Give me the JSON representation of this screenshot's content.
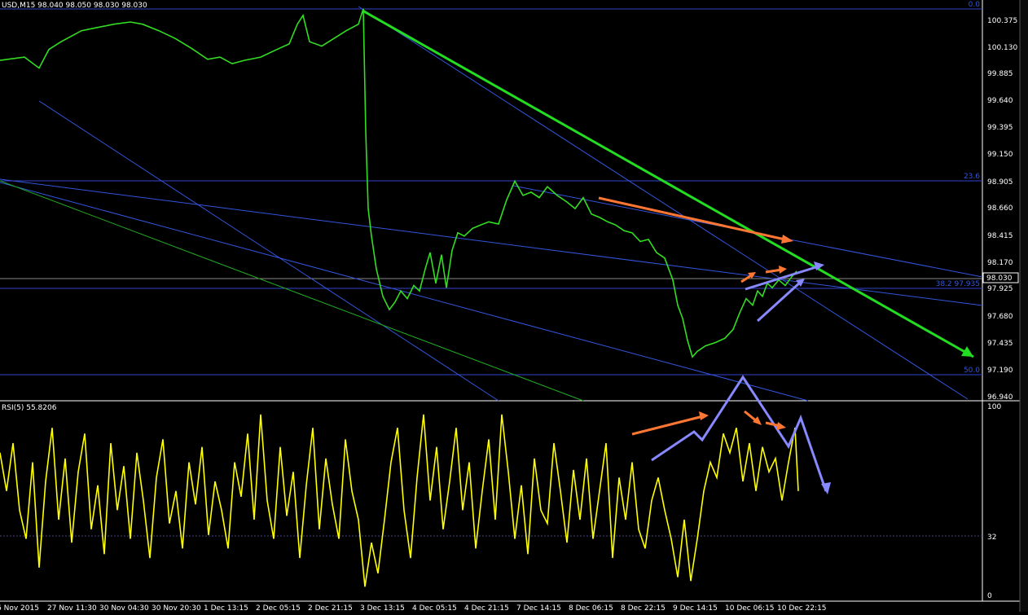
{
  "chart_data": [
    {
      "type": "line",
      "panel": "price",
      "title": "USD,M15  98.040 98.050 98.030 98.030",
      "current_price_label": "98.030",
      "ylim": [
        96.85,
        100.5
      ],
      "y_ticks": [
        100.375,
        100.13,
        99.885,
        99.64,
        99.395,
        99.15,
        98.905,
        98.66,
        98.415,
        98.17,
        97.925,
        97.68,
        97.435,
        97.19,
        96.94
      ],
      "y_tick_labels": [
        "100.375",
        "100.130",
        "99.885",
        "99.640",
        "99.395",
        "99.150",
        "98.905",
        "98.660",
        "98.415",
        "98.170",
        "97.925",
        "97.680",
        "97.435",
        "97.190",
        "96.940"
      ],
      "series": [
        {
          "color": "#33dd22",
          "x": [
            0,
            30,
            48,
            60,
            75,
            100,
            120,
            140,
            160,
            175,
            195,
            215,
            235,
            255,
            270,
            285,
            300,
            320,
            340,
            355,
            365,
            372,
            380,
            395,
            410,
            425,
            440,
            446,
            449,
            452,
            456,
            462,
            470,
            478,
            485,
            492,
            500,
            508,
            515,
            522,
            528,
            535,
            542,
            548,
            555,
            562,
            570,
            580,
            590,
            600,
            612,
            622,
            632,
            642,
            652,
            662,
            672,
            684,
            696,
            706,
            716,
            726,
            736,
            746,
            756,
            766,
            776,
            786,
            796,
            806,
            816,
            826,
            832,
            838,
            844,
            850,
            856,
            866,
            878,
            890,
            900,
            908,
            916,
            924,
            930,
            936,
            942,
            948,
            956,
            964,
            972,
            978
          ],
          "values": [
            99.95,
            99.98,
            99.88,
            100.05,
            100.12,
            100.22,
            100.25,
            100.28,
            100.3,
            100.28,
            100.22,
            100.15,
            100.06,
            99.96,
            99.98,
            99.92,
            99.95,
            99.98,
            100.05,
            100.1,
            100.28,
            100.36,
            100.12,
            100.08,
            100.15,
            100.22,
            100.28,
            100.42,
            99.3,
            98.6,
            98.35,
            98.05,
            97.8,
            97.68,
            97.75,
            97.85,
            97.78,
            97.9,
            97.85,
            98.05,
            98.2,
            97.92,
            98.18,
            97.88,
            98.22,
            98.38,
            98.35,
            98.42,
            98.45,
            98.48,
            98.46,
            98.68,
            98.85,
            98.72,
            98.75,
            98.7,
            98.8,
            98.72,
            98.66,
            98.6,
            98.7,
            98.55,
            98.52,
            98.48,
            98.45,
            98.4,
            98.38,
            98.3,
            98.32,
            98.2,
            98.15,
            97.95,
            97.72,
            97.6,
            97.4,
            97.25,
            97.3,
            97.35,
            97.38,
            97.42,
            97.5,
            97.65,
            97.78,
            97.72,
            97.85,
            97.8,
            97.92,
            97.88,
            97.95,
            97.9,
            97.98,
            98.03
          ]
        }
      ],
      "fibo_levels": [
        {
          "label": "0.0"
        },
        {
          "label": "23.6"
        },
        {
          "label": "38.2 97.935"
        },
        {
          "label": "50.0"
        }
      ]
    },
    {
      "type": "line",
      "panel": "indicator",
      "title": "RSI(5) 55.8206",
      "ylim": [
        0,
        100
      ],
      "y_ticks": [
        100,
        32,
        0
      ],
      "y_tick_labels": [
        "100",
        "32",
        "0"
      ],
      "series": [
        {
          "color": "#ffff00",
          "x": [
            0,
            8,
            16,
            24,
            32,
            40,
            48,
            56,
            64,
            72,
            80,
            88,
            96,
            104,
            112,
            120,
            128,
            136,
            144,
            152,
            160,
            168,
            176,
            184,
            192,
            200,
            208,
            216,
            224,
            232,
            240,
            248,
            256,
            264,
            272,
            280,
            288,
            296,
            304,
            312,
            320,
            328,
            336,
            344,
            352,
            360,
            368,
            376,
            384,
            392,
            400,
            408,
            416,
            424,
            432,
            440,
            448,
            456,
            464,
            472,
            480,
            488,
            496,
            504,
            512,
            520,
            528,
            536,
            544,
            552,
            560,
            568,
            576,
            584,
            592,
            600,
            608,
            616,
            624,
            632,
            640,
            648,
            656,
            664,
            672,
            680,
            688,
            696,
            704,
            712,
            720,
            728,
            736,
            744,
            752,
            760,
            768,
            776,
            784,
            792,
            800,
            808,
            816,
            824,
            832,
            840,
            848,
            856,
            864,
            872,
            880,
            888,
            896,
            904,
            912,
            920,
            928,
            936,
            944,
            952,
            960,
            968,
            976,
            980
          ],
          "values": [
            75,
            55,
            80,
            45,
            30,
            70,
            15,
            60,
            88,
            40,
            72,
            28,
            65,
            85,
            35,
            58,
            22,
            80,
            45,
            68,
            30,
            75,
            50,
            20,
            62,
            82,
            38,
            55,
            25,
            70,
            48,
            78,
            32,
            60,
            45,
            25,
            70,
            52,
            85,
            40,
            95,
            50,
            30,
            78,
            42,
            65,
            20,
            58,
            88,
            35,
            72,
            48,
            30,
            82,
            55,
            40,
            5,
            28,
            12,
            40,
            70,
            88,
            45,
            20,
            62,
            95,
            50,
            78,
            35,
            60,
            88,
            45,
            70,
            25,
            55,
            82,
            40,
            95,
            65,
            30,
            58,
            22,
            72,
            45,
            38,
            80,
            55,
            28,
            66,
            40,
            72,
            30,
            55,
            80,
            20,
            62,
            40,
            70,
            35,
            25,
            50,
            62,
            45,
            30,
            10,
            40,
            8,
            30,
            55,
            70,
            62,
            85,
            75,
            88,
            60,
            80,
            55,
            78,
            65,
            72,
            50,
            70,
            88,
            55
          ]
        }
      ]
    }
  ],
  "time_axis": [
    "6 Nov 2015",
    "27 Nov 11:30",
    "30 Nov 04:30",
    "30 Nov 20:30",
    "1 Dec 13:15",
    "2 Dec 05:15",
    "2 Dec 21:15",
    "3 Dec 13:15",
    "4 Dec 05:15",
    "4 Dec 21:15",
    "7 Dec 14:15",
    "8 Dec 06:15",
    "8 Dec 22:15",
    "9 Dec 14:15",
    "10 Dec 06:15",
    "10 Dec 22:15"
  ],
  "colors": {
    "background": "#000000",
    "price_line": "#33dd22",
    "rsi_line": "#ffff00",
    "trend_line": "#22dd22",
    "channel_lines": "#3355dd",
    "fibo_lines": "#3344cc",
    "annotation_orange": "#ff7733",
    "annotation_violet": "#8888ff",
    "axis_text": "#ffffff"
  }
}
